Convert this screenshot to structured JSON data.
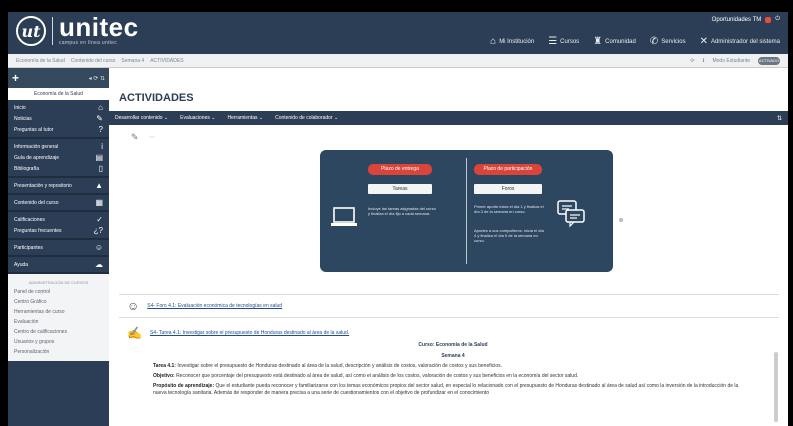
{
  "header": {
    "logo_mark": "ut",
    "logo_text": "unitec",
    "logo_sub": "campus en línea unitec",
    "user_label": "Oportunidades TM",
    "nav": [
      {
        "icon": "home-icon",
        "glyph": "⌂",
        "label": "Mi Institución"
      },
      {
        "icon": "courses-icon",
        "glyph": "☰",
        "label": "Cursos"
      },
      {
        "icon": "community-icon",
        "glyph": "♜",
        "label": "Comunidad"
      },
      {
        "icon": "services-icon",
        "glyph": "✆",
        "label": "Servicios"
      },
      {
        "icon": "admin-icon",
        "glyph": "✕",
        "label": "Administrador del sistema"
      }
    ]
  },
  "breadcrumb": {
    "items": [
      "Economía de la Salud",
      "Contenido del curso",
      "Semana 4",
      "ACTIVIDADES"
    ],
    "right_label": "Modo Estudiante",
    "toggle": "ACTIVADO"
  },
  "sidebar": {
    "course_title": "Economía de la Salud",
    "groups": [
      [
        {
          "label": "Inicio",
          "icon": "home-icon",
          "glyph": "⌂"
        },
        {
          "label": "Noticias",
          "icon": "megaphone-icon",
          "glyph": "✎"
        },
        {
          "label": "Preguntas al tutor",
          "icon": "question-icon",
          "glyph": "?"
        }
      ],
      [
        {
          "label": "Información general",
          "icon": "info-icon",
          "glyph": "i"
        },
        {
          "label": "Guía de aprendizaje",
          "icon": "book-icon",
          "glyph": "▤"
        },
        {
          "label": "Bibliografía",
          "icon": "document-icon",
          "glyph": "▯"
        }
      ],
      [
        {
          "label": "Presentación y repositorio",
          "icon": "presentation-icon",
          "glyph": "▲"
        }
      ],
      [
        {
          "label": "Contenido del curso",
          "icon": "content-icon",
          "glyph": "▦"
        }
      ],
      [
        {
          "label": "Calificaciones",
          "icon": "check-icon",
          "glyph": "✓"
        },
        {
          "label": "Preguntas frecuentes",
          "icon": "faq-icon",
          "glyph": "¿?"
        }
      ],
      [
        {
          "label": "Participantes",
          "icon": "users-icon",
          "glyph": "☺"
        }
      ],
      [
        {
          "label": "Ayuda",
          "icon": "help-icon",
          "glyph": "☁"
        }
      ]
    ],
    "admin_heading": "ADMINISTRACIÓN DE CURSOS",
    "admin_items": [
      "Panel de control",
      "Centro Gráfico",
      "Herramientas de curso",
      "Evaluación",
      "Centro de calificaciones",
      "Usuarios y grupos",
      "Personalización"
    ]
  },
  "main": {
    "title": "ACTIVIDADES",
    "menu": [
      "Desarrollar contenido",
      "Evaluaciones",
      "Herramientas",
      "Contenido de colaborador"
    ],
    "banner": {
      "left_button": "Plazo de entrega",
      "left_white": "Tareas",
      "left_text": "Incluye las tareas asignadas del curso y finaliza el día fijo a cada semana.",
      "right_button": "Plazo de participación",
      "right_white": "Foros",
      "right_text_1": "Primer aporte inicia el día 1 y finaliza el día 3 de la semana en curso.",
      "right_text_2": "Aportes a sus compañeros: inicia el día 4 y finaliza el día 5 de la semana en curso."
    },
    "forum_link": "S4- Foro 4.1: Evaluación económica de tecnologías en salud",
    "task_link": "S4- Tarea 4.1: Investigar sobre el presupuesto de Honduras destinado al área de la salud.",
    "doc": {
      "course_line": "Curso: Economía de la Salud",
      "week_line": "Semana 4",
      "task_label": "Tarea 4.1:",
      "task_text": "Investigar sobre el presupuesto de Honduras destinado al área de la salud, descripción y análisis de costos, valoración de costos y sus beneficios.",
      "objective_label": "Objetivo:",
      "objective_text": "Reconocer que porcentaje del presupuesto está destinado al área de salud, así como el análisis de los costos, valoración de costos y sus beneficios en la economía del sector salud.",
      "purpose_label": "Propósito de aprendizaje:",
      "purpose_text": "Que el estudiante pueda reconocer y familiarizarse con los temas económicos propios del sector salud, en especial lo relacionado con el presupuesto de Honduras destinado al área de salud así como la inversión de la introducción de la nueva tecnología sanitaria. Además de responder de manera precisa a una serie de cuestionamientos con el objetivo de profundizar en el conocimiento"
    }
  }
}
